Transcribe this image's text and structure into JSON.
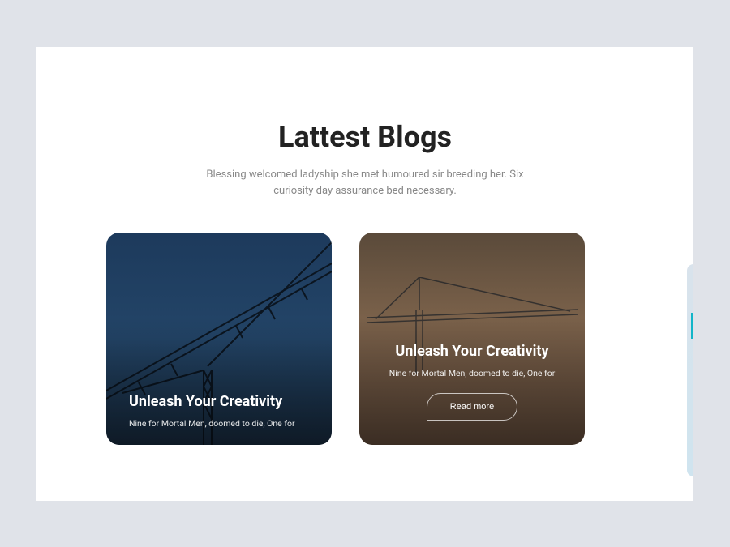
{
  "section": {
    "title": "Lattest Blogs",
    "description": "Blessing welcomed ladyship she met humoured sir breeding her. Six curiosity day assurance bed necessary."
  },
  "cards": [
    {
      "title": "Unleash Your Creativity",
      "excerpt": "Nine for Mortal Men, doomed to die, One for"
    },
    {
      "title": "Unleash Your Creativity",
      "excerpt": "Nine for Mortal Men, doomed to die, One for",
      "cta": "Read more"
    }
  ]
}
